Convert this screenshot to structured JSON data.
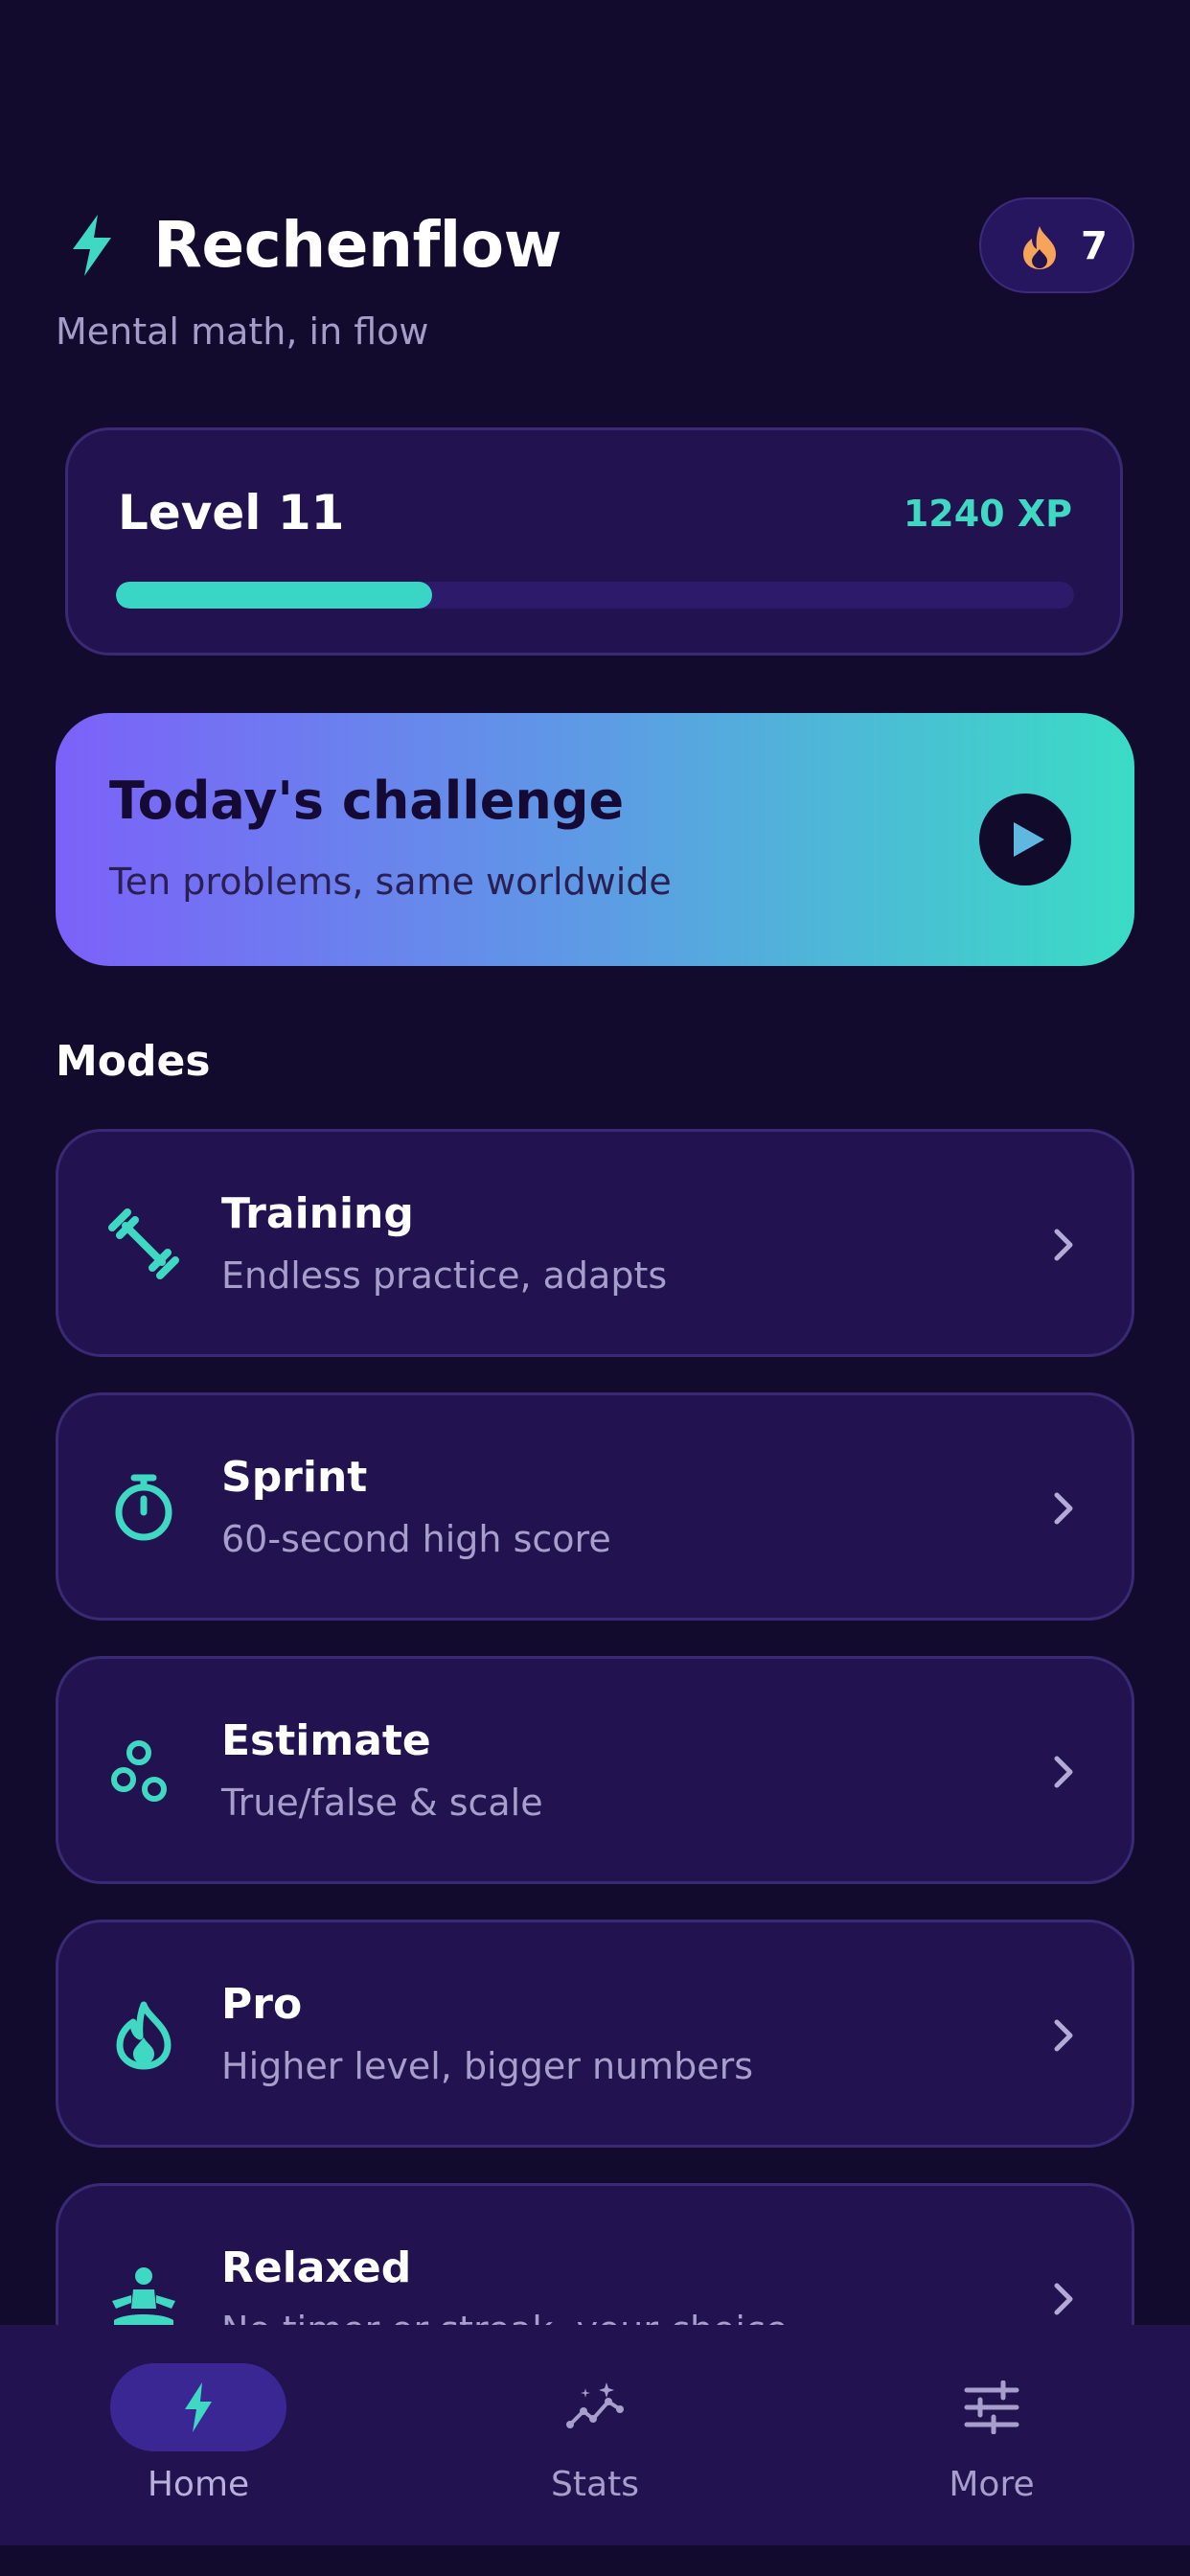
{
  "colors": {
    "background": "#130b2e",
    "card": "#22124f",
    "card_border": "#3a2a75",
    "accent_teal": "#3ed8c3",
    "accent_violet": "#7c61f9",
    "streak_flame": "#f5a45a",
    "muted_text": "#a79ecb"
  },
  "header": {
    "title": "Rechenflow",
    "logo_icon": "lightning-bolt-icon",
    "subtitle": "Mental math, in flow",
    "streak": {
      "icon": "flame-icon",
      "count": "7"
    }
  },
  "level": {
    "label": "Level 11",
    "xp": "1240 XP",
    "progress": 0.33
  },
  "challenge": {
    "title": "Today's challenge",
    "subtitle": "Ten problems, same worldwide",
    "action_icon": "play-icon"
  },
  "modes": {
    "section_title": "Modes",
    "items": [
      {
        "icon": "dumbbell-icon",
        "title": "Training",
        "subtitle": "Endless practice, adapts"
      },
      {
        "icon": "stopwatch-icon",
        "title": "Sprint",
        "subtitle": "60-second high score"
      },
      {
        "icon": "bubbles-icon",
        "title": "Estimate",
        "subtitle": "True/false & scale"
      },
      {
        "icon": "flame-icon",
        "title": "Pro",
        "subtitle": "Higher level, bigger numbers"
      },
      {
        "icon": "meditation-icon",
        "title": "Relaxed",
        "subtitle": "No timer or streak, your choice"
      }
    ]
  },
  "nav": {
    "items": [
      {
        "icon": "lightning-bolt-icon",
        "label": "Home",
        "active": true
      },
      {
        "icon": "stats-sparkle-icon",
        "label": "Stats",
        "active": false
      },
      {
        "icon": "sliders-icon",
        "label": "More",
        "active": false
      }
    ]
  }
}
